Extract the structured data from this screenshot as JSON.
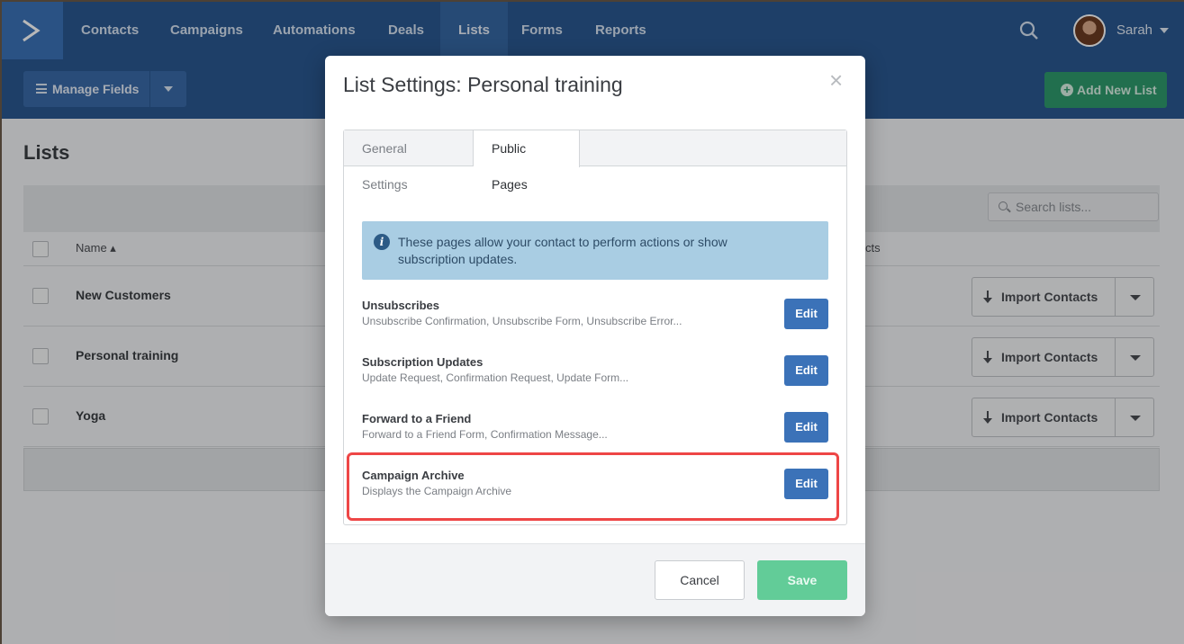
{
  "nav": {
    "items": [
      "Contacts",
      "Campaigns",
      "Automations",
      "Deals",
      "Lists",
      "Forms",
      "Reports"
    ],
    "active": "Lists",
    "user": "Sarah"
  },
  "toolbar": {
    "manage_fields": "Manage Fields",
    "add_new_list": "Add New List"
  },
  "lists_page": {
    "title": "Lists",
    "search_placeholder": "Search lists...",
    "col_name": "Name",
    "col_contacts_partial": "cts",
    "rows": [
      {
        "name": "New Customers",
        "action": "Import Contacts"
      },
      {
        "name": "Personal training",
        "action": "Import Contacts"
      },
      {
        "name": "Yoga",
        "action": "Import Contacts"
      }
    ]
  },
  "modal": {
    "title": "List Settings: Personal training",
    "tabs": [
      "General Settings",
      "Public Pages"
    ],
    "active_tab": "Public Pages",
    "info": "These pages allow your contact to perform actions or show subscription updates.",
    "pages": [
      {
        "title": "Unsubscribes",
        "subtitle": "Unsubscribe Confirmation, Unsubscribe Form, Unsubscribe Error...",
        "button": "Edit"
      },
      {
        "title": "Subscription Updates",
        "subtitle": "Update Request, Confirmation Request, Update Form...",
        "button": "Edit"
      },
      {
        "title": "Forward to a Friend",
        "subtitle": "Forward to a Friend Form, Confirmation Message...",
        "button": "Edit"
      },
      {
        "title": "Campaign Archive",
        "subtitle": "Displays the Campaign Archive",
        "button": "Edit"
      }
    ],
    "cancel": "Cancel",
    "save": "Save"
  },
  "colors": {
    "nav": "#2a5890",
    "primary_button": "#3b72b8",
    "save_button": "#62cc98",
    "highlight": "#ee4646"
  }
}
